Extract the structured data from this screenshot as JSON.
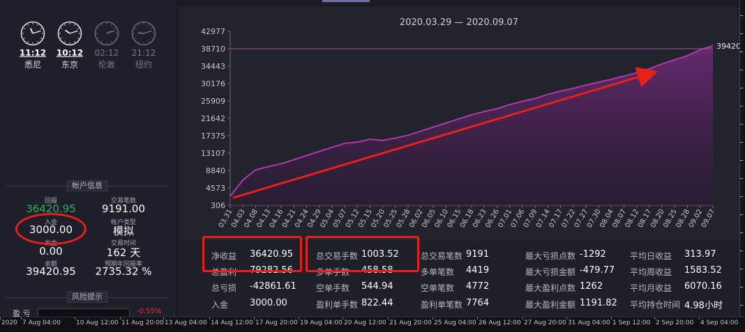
{
  "clocks": [
    {
      "time": "11:12",
      "city": "悉尼",
      "active": true,
      "h": 11,
      "m": 12
    },
    {
      "time": "10:12",
      "city": "东京",
      "active": true,
      "h": 10,
      "m": 12
    },
    {
      "time": "02:12",
      "city": "伦敦",
      "active": false,
      "h": 2,
      "m": 12
    },
    {
      "time": "21:12",
      "city": "纽约",
      "active": false,
      "h": 21,
      "m": 12
    }
  ],
  "account": {
    "header": "帐户信息",
    "drawdown_label": "回报",
    "drawdown_value": "36420.95",
    "deposit_label": "入金",
    "deposit_value": "3000.00",
    "withdraw_label": "出金",
    "withdraw_value": "0.00",
    "balance_label": "余额",
    "balance_value": "39420.95",
    "trades_label": "交易笔数",
    "trades_value": "9191.00",
    "type_label": "帐户类型",
    "type_value": "模拟",
    "time_label": "交易时间",
    "time_value": "162 天",
    "annual_label": "预期年回报率",
    "annual_value": "2735.32 %"
  },
  "risk": {
    "header": "风险提示",
    "row_label": "盈 亏",
    "row_value": "-0.55%"
  },
  "chart_data": {
    "type": "area",
    "title": "2020.03.29 — 2020.09.07",
    "y_ticks": [
      "42977",
      "38710",
      "34443",
      "30176",
      "25909",
      "21642",
      "17375",
      "13107",
      "8840",
      "4573",
      "306"
    ],
    "ylim": [
      306,
      42977
    ],
    "last_value_label": "39420",
    "x_ticks": [
      "03.31",
      "04.03",
      "04.08",
      "04.13",
      "04.16",
      "04.21",
      "04.24",
      "04.29",
      "05.04",
      "05.07",
      "05.12",
      "05.15",
      "05.20",
      "05.25",
      "05.28",
      "06.02",
      "06.05",
      "06.10",
      "06.15",
      "06.18",
      "06.23",
      "06.26",
      "07.01",
      "07.06",
      "07.09",
      "07.14",
      "07.17",
      "07.22",
      "07.27",
      "07.30",
      "08.04",
      "08.07",
      "08.12",
      "08.17",
      "08.20",
      "08.25",
      "08.28",
      "09.02",
      "09.07"
    ],
    "x": [
      0,
      1,
      2,
      3,
      4,
      5,
      6,
      7,
      8,
      9,
      10,
      11,
      12,
      13,
      14,
      15,
      16,
      17,
      18,
      19,
      20,
      21,
      22,
      23,
      24,
      25,
      26,
      27,
      28,
      29,
      30,
      31,
      32,
      33,
      34,
      35,
      36,
      37,
      38
    ],
    "values": [
      2500,
      6500,
      9000,
      9800,
      10500,
      11500,
      12500,
      13500,
      14500,
      15500,
      15800,
      16500,
      16200,
      16800,
      17500,
      18500,
      19500,
      20500,
      21500,
      22500,
      23300,
      24000,
      25000,
      25800,
      26500,
      27500,
      28300,
      29000,
      29800,
      30500,
      31200,
      32000,
      32800,
      33800,
      35000,
      36000,
      37000,
      38500,
      39420
    ],
    "reference_value": 38710,
    "colors": {
      "line": "#b03aa8",
      "fill": "#4a2050",
      "arrow": "#e8201a",
      "ref_line": "#a050a0"
    }
  },
  "stats": [
    [
      {
        "label": "净收益",
        "value": "36420.95"
      },
      {
        "label": "总盈利",
        "value": "79282.56"
      },
      {
        "label": "总亏损",
        "value": "-42861.61"
      },
      {
        "label": "入金",
        "value": "3000.00"
      }
    ],
    [
      {
        "label": "总交易手数",
        "value": "1003.52"
      },
      {
        "label": "多单手数",
        "value": "458.58"
      },
      {
        "label": "空单手数",
        "value": "544.94"
      },
      {
        "label": "盈利单手数",
        "value": "822.44"
      }
    ],
    [
      {
        "label": "总交易笔数",
        "value": "9191"
      },
      {
        "label": "多单笔数",
        "value": "4419"
      },
      {
        "label": "空单笔数",
        "value": "4772"
      },
      {
        "label": "盈利单笔数",
        "value": "7764"
      }
    ],
    [
      {
        "label": "最大亏损点数",
        "value": "-1292"
      },
      {
        "label": "最大亏损金额",
        "value": "-479.77"
      },
      {
        "label": "最大盈利点数",
        "value": "1262"
      },
      {
        "label": "最大盈利金额",
        "value": "1191.82"
      }
    ],
    [
      {
        "label": "平均日收益",
        "value": "313.97"
      },
      {
        "label": "平均周收益",
        "value": "1583.52"
      },
      {
        "label": "平均月收益",
        "value": "6070.16"
      },
      {
        "label": "平均持仓时间",
        "value": "4.98小时"
      }
    ]
  ],
  "bottom_axis": [
    "2020",
    "7 Aug 04:00",
    "10 Aug 12:00",
    "11 Aug 20:00",
    "13 Aug 04:00",
    "14 Aug 12:00",
    "17 Aug 20:00",
    "19 Aug 04:00",
    "20 Aug 12:00",
    "21 Aug 20:00",
    "25 Aug 04:00",
    "26 Aug 12:00",
    "27 Aug 20:00",
    "31 Aug 04:00",
    "1 Sep 12:00",
    "2 Sep 20:00",
    "4 Sep 04:00"
  ]
}
